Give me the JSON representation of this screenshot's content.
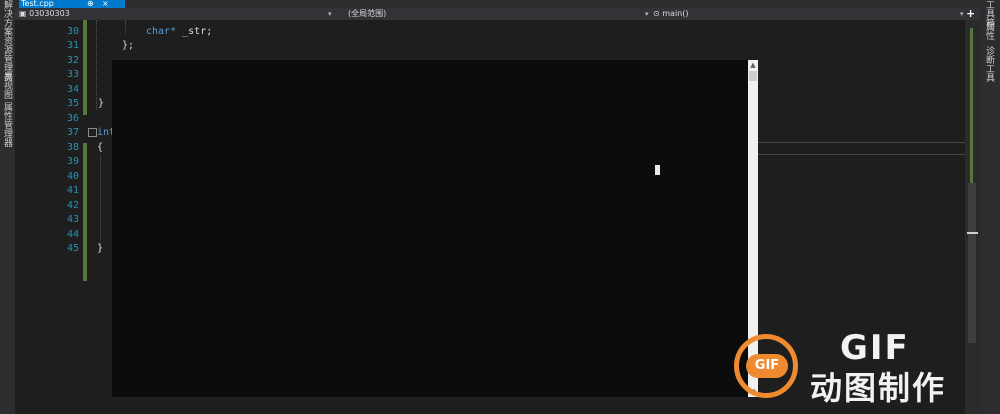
{
  "left_panel": {
    "tabs": [
      "解决方案资源管理器",
      "类视图",
      "属性管理器"
    ]
  },
  "right_panel": {
    "tabs": [
      "工具箱",
      "属性",
      "诊断工具"
    ]
  },
  "tab_bar": {
    "active_tab": "Test.cpp",
    "pin": "⊕",
    "close": "×"
  },
  "nav_bar": {
    "project": "03030303",
    "scope": "(全局范围)",
    "member": "main()",
    "add": "+"
  },
  "editor": {
    "line_numbers": [
      "30",
      "31",
      "32",
      "33",
      "34",
      "35",
      "36",
      "37",
      "38",
      "39",
      "40",
      "41",
      "42",
      "43",
      "44",
      "45"
    ],
    "line30_type": "char*",
    "line30_rest": " _str;",
    "line31": "};",
    "line35": "}",
    "line37": "int",
    "line38": "{",
    "line45": "}"
  },
  "console": {
    "scroll_up": "▲",
    "scroll_down": "▼"
  },
  "watermark": {
    "badge": "GIF",
    "big": "GIF",
    "text": "动图制作"
  }
}
